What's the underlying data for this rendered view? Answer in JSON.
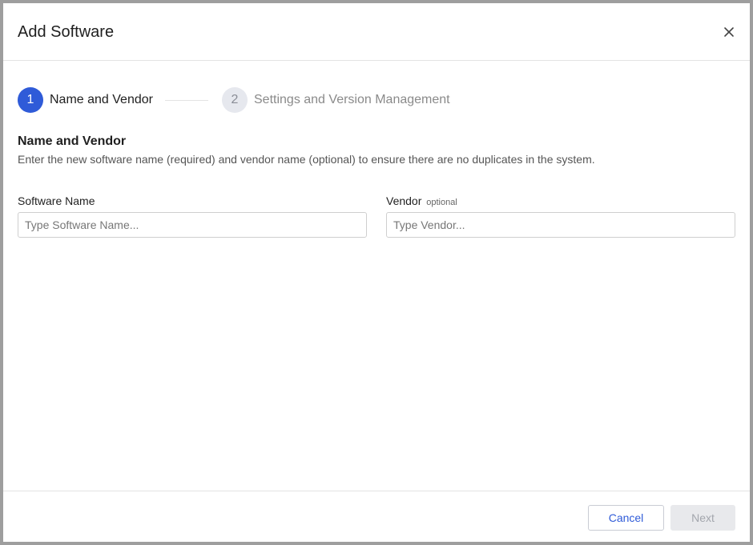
{
  "dialog": {
    "title": "Add Software",
    "close_icon": "close-icon"
  },
  "stepper": {
    "steps": [
      {
        "number": "1",
        "label": "Name and Vendor",
        "state": "active"
      },
      {
        "number": "2",
        "label": "Settings and Version Management",
        "state": "inactive"
      }
    ]
  },
  "section": {
    "title": "Name and Vendor",
    "description": "Enter the new software name (required) and vendor name (optional) to ensure there are no duplicates in the system."
  },
  "fields": {
    "software_name": {
      "label": "Software Name",
      "placeholder": "Type Software Name...",
      "value": ""
    },
    "vendor": {
      "label": "Vendor",
      "optional_tag": "optional",
      "placeholder": "Type Vendor...",
      "value": ""
    }
  },
  "footer": {
    "cancel_label": "Cancel",
    "next_label": "Next",
    "next_disabled": true
  },
  "colors": {
    "accent": "#2f5bd8",
    "step_inactive_bg": "#e6e8ee",
    "border": "#e3e3e3",
    "disabled_bg": "#e8e9ec"
  }
}
